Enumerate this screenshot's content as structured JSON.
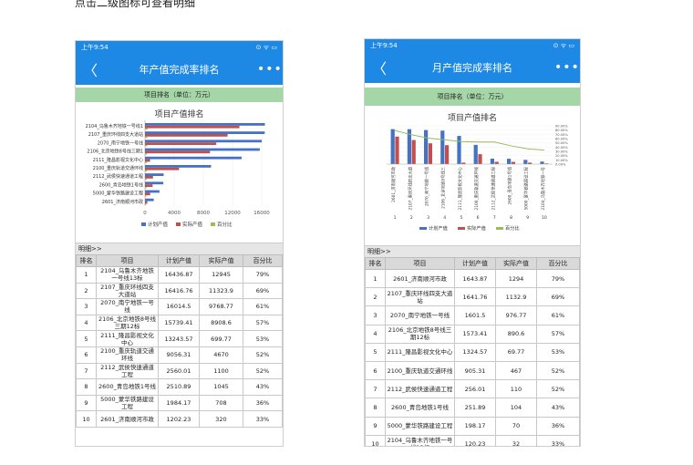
{
  "caption": "点击二级图标可查看明细",
  "status_time": "上午9:54",
  "status_icons": "⊙ ᯤ ▭",
  "back_glyph": "〈",
  "more_glyph": "•••",
  "detail_label": "明细>>",
  "table_headers": [
    "排名",
    "项目",
    "计划产值",
    "实际产值",
    "百分比"
  ],
  "colors": {
    "plan": "#4472c4",
    "actual": "#c0504d",
    "pct": "#9bbb59",
    "bar_title": "#1e88e5"
  },
  "year_screen": {
    "page_title": "年产值完成率排名",
    "rank_header": "项目排名（单位：万元）",
    "rows": [
      {
        "rank": "1",
        "name": "2104_乌鲁木齐地铁一号线13标",
        "plan": "16436.87",
        "actual": "12945",
        "pct": "79%"
      },
      {
        "rank": "2",
        "name": "2107_重庆环线四支大道站",
        "plan": "16416.76",
        "actual": "11323.9",
        "pct": "69%"
      },
      {
        "rank": "3",
        "name": "2070_南宁地铁一号线",
        "plan": "16014.5",
        "actual": "9768.77",
        "pct": "61%"
      },
      {
        "rank": "4",
        "name": "2106_北京地铁8号线三期12标",
        "plan": "15739.41",
        "actual": "8908.6",
        "pct": "57%"
      },
      {
        "rank": "5",
        "name": "2111_隆昌影视文化中心",
        "plan": "13243.57",
        "actual": "699.77",
        "pct": "53%"
      },
      {
        "rank": "6",
        "name": "2100_重庆轨道交通环线",
        "plan": "9056.31",
        "actual": "4670",
        "pct": "52%"
      },
      {
        "rank": "7",
        "name": "2112_武侯快速通道工程",
        "plan": "2560.01",
        "actual": "1100",
        "pct": "52%"
      },
      {
        "rank": "8",
        "name": "2600_青岛地铁1号线",
        "plan": "2510.89",
        "actual": "1045",
        "pct": "43%"
      },
      {
        "rank": "9",
        "name": "5000_蒙华铁路建设工程",
        "plan": "1984.17",
        "actual": "708",
        "pct": "36%"
      },
      {
        "rank": "10",
        "name": "2601_济南顺河市政",
        "plan": "1202.23",
        "actual": "320",
        "pct": "33%"
      }
    ]
  },
  "month_screen": {
    "page_title": "月产值完成率排名",
    "rank_header": "项目排名（单位：万元）",
    "rows": [
      {
        "rank": "1",
        "name": "2601_济南顺河市政",
        "plan": "1643.87",
        "actual": "1294",
        "pct": "79%"
      },
      {
        "rank": "2",
        "name": "2107_重庆环线四支大道站",
        "plan": "1641.76",
        "actual": "1132.9",
        "pct": "69%"
      },
      {
        "rank": "3",
        "name": "2070_南宁地铁一号线",
        "plan": "1601.5",
        "actual": "976.77",
        "pct": "61%"
      },
      {
        "rank": "4",
        "name": "2106_北京地铁8号线三期12标",
        "plan": "1573.41",
        "actual": "890.6",
        "pct": "57%"
      },
      {
        "rank": "5",
        "name": "2111_隆昌影视文化中心",
        "plan": "1324.57",
        "actual": "69.77",
        "pct": "53%"
      },
      {
        "rank": "6",
        "name": "2100_重庆轨道交通环线",
        "plan": "905.31",
        "actual": "467",
        "pct": "52%"
      },
      {
        "rank": "7",
        "name": "2112_武侯快速通道工程",
        "plan": "256.01",
        "actual": "110",
        "pct": "52%"
      },
      {
        "rank": "8",
        "name": "2600_青岛地铁1号线",
        "plan": "251.89",
        "actual": "104",
        "pct": "43%"
      },
      {
        "rank": "9",
        "name": "5000_蒙华铁路建设工程",
        "plan": "198.17",
        "actual": "70",
        "pct": "36%"
      },
      {
        "rank": "10",
        "name": "2104_乌鲁木齐地铁一号线13标",
        "plan": "120.23",
        "actual": "32",
        "pct": "33%"
      }
    ]
  },
  "chart_data": [
    {
      "type": "bar",
      "orientation": "horizontal",
      "title": "项目产值排名",
      "categories": [
        "2104_乌鲁木齐地铁一号线13标",
        "2107_重庆环线四支大道站",
        "2070_南宁地铁一号线",
        "2106_北京地铁8号线三期12标",
        "2111_隆昌影视文化中心",
        "2100_重庆轨道交通环线",
        "2112_武侯快速通道工程",
        "2600_青岛地铁1号线",
        "5000_蒙华铁路建设工程",
        "2601_济南顺河市政"
      ],
      "series": [
        {
          "name": "计划产值",
          "values": [
            16436.87,
            16416.76,
            16014.5,
            15739.41,
            13243.57,
            9056.31,
            2560.01,
            2510.89,
            1984.17,
            1202.23
          ]
        },
        {
          "name": "实际产值",
          "values": [
            12945,
            11323.9,
            9768.77,
            8908.6,
            699.77,
            4670,
            1100,
            1045,
            708,
            320
          ]
        },
        {
          "name": "百分比",
          "values": [
            79,
            69,
            61,
            57,
            53,
            52,
            52,
            43,
            36,
            33
          ]
        }
      ],
      "x_ticks": [
        "0",
        "4000",
        "8000",
        "12000",
        "16000"
      ],
      "xlim": [
        0,
        18000
      ],
      "legend": "bottom"
    },
    {
      "type": "bar",
      "title": "项目产值排名",
      "categories": [
        "1",
        "2",
        "3",
        "4",
        "5",
        "6",
        "7",
        "8",
        "9",
        "10"
      ],
      "series": [
        {
          "name": "计划产值",
          "values": [
            1643.87,
            1641.76,
            1601.5,
            1573.41,
            1324.57,
            905.31,
            256.01,
            251.89,
            198.17,
            120.23
          ]
        },
        {
          "name": "实际产值",
          "values": [
            1294,
            1132.9,
            976.77,
            890.6,
            69.77,
            467,
            110,
            104,
            70,
            32
          ]
        },
        {
          "name": "百分比",
          "values": [
            79,
            69,
            61,
            57,
            53,
            52,
            52,
            43,
            36,
            33
          ]
        }
      ],
      "y2_ticks": [
        "0.00%",
        "10.00%",
        "20.00%",
        "30.00%",
        "40.00%",
        "50.00%",
        "60.00%",
        "70.00%",
        "80.00%",
        "90.00%"
      ],
      "legend": "bottom"
    }
  ]
}
